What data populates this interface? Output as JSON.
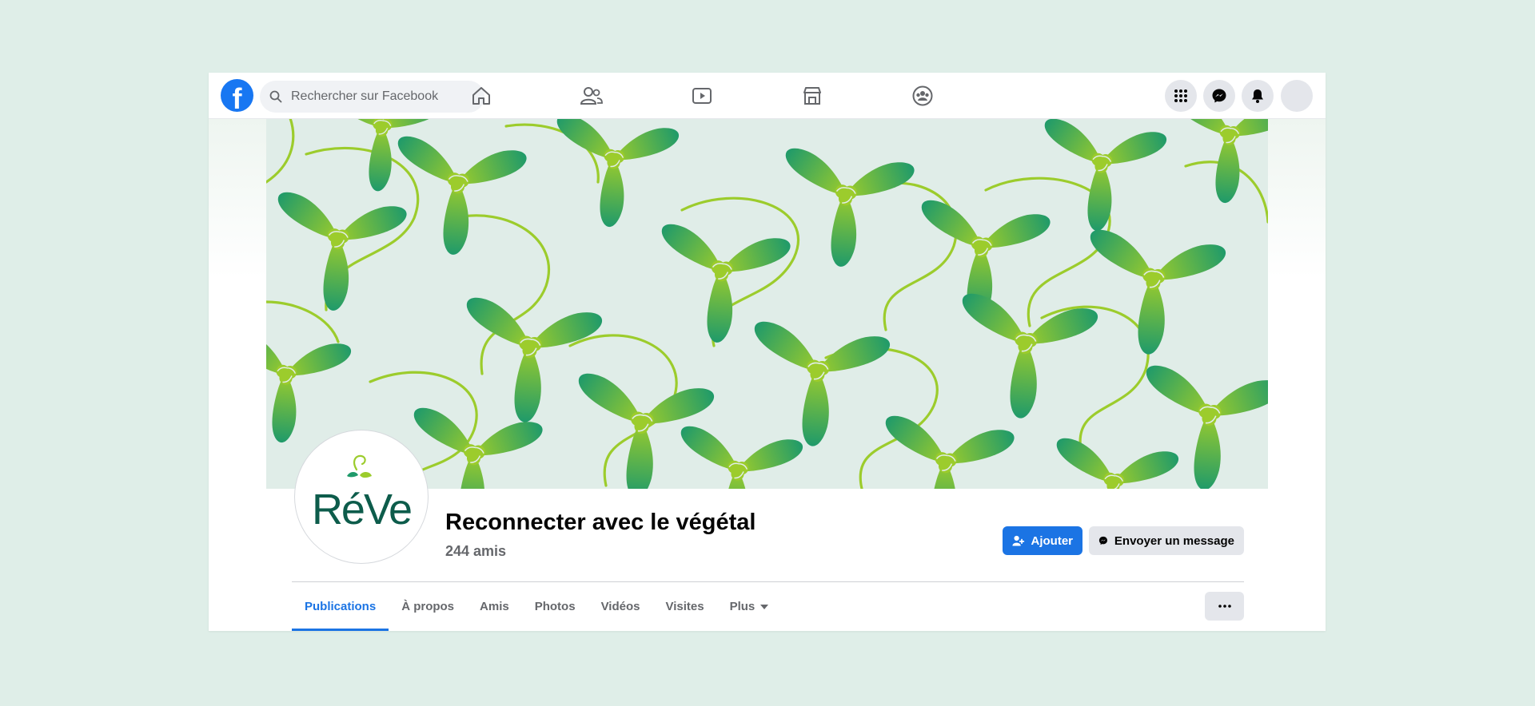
{
  "search": {
    "placeholder": "Rechercher sur Facebook"
  },
  "nav": {
    "icons": [
      "home-icon",
      "friends-icon",
      "watch-icon",
      "marketplace-icon",
      "groups-icon"
    ],
    "right_icons": [
      "menu-grid-icon",
      "messenger-icon",
      "notifications-icon",
      "account-avatar"
    ]
  },
  "profile": {
    "logo_text": "RéVe",
    "name": "Reconnecter avec le végétal",
    "friends": "244 amis"
  },
  "actions": {
    "add_label": "Ajouter",
    "message_label": "Envoyer un message"
  },
  "tabs": [
    "Publications",
    "À propos",
    "Amis",
    "Photos",
    "Vidéos",
    "Visites",
    "Plus"
  ],
  "colors": {
    "brand_blue": "#1877f2",
    "accent_blue": "#1b74e4",
    "leaf_dark": "#1f9a6a",
    "leaf_light": "#9ccc2c",
    "logo_green": "#0d5c4b"
  }
}
